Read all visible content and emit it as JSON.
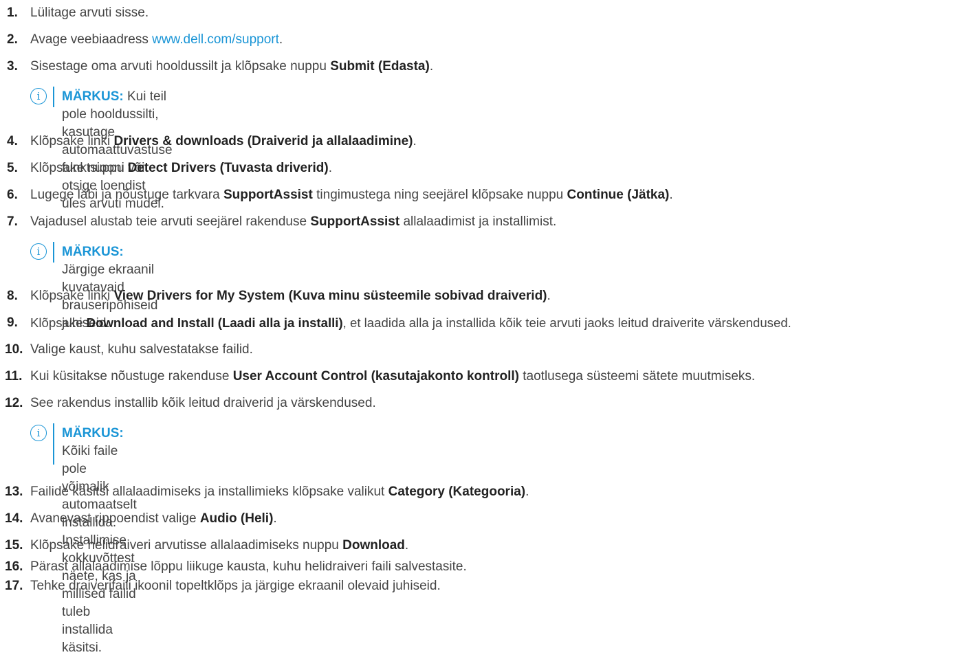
{
  "steps": [
    {
      "n": "1.",
      "parts": [
        {
          "t": "Lülitage arvuti sisse."
        }
      ]
    },
    {
      "n": "2.",
      "parts": [
        {
          "t": "Avage veebiaadress "
        },
        {
          "t": "www.dell.com/support",
          "link": true
        },
        {
          "t": "."
        }
      ]
    },
    {
      "n": "3.",
      "parts": [
        {
          "t": "Sisestage oma arvuti hooldussilt ja klõpsake nuppu "
        },
        {
          "t": "Submit (Edasta)",
          "b": true
        },
        {
          "t": "."
        }
      ]
    },
    {
      "n": "4.",
      "parts": [
        {
          "t": "Klõpsake linki "
        },
        {
          "t": "Drivers & downloads (Draiverid ja allalaadimine)",
          "b": true
        },
        {
          "t": "."
        }
      ]
    },
    {
      "n": "5.",
      "parts": [
        {
          "t": "Klõpsake nuppu "
        },
        {
          "t": "Detect Drivers (Tuvasta driverid)",
          "b": true
        },
        {
          "t": "."
        }
      ]
    },
    {
      "n": "6.",
      "parts": [
        {
          "t": "Lugege läbi ja nõustuge tarkvara "
        },
        {
          "t": "SupportAssist",
          "b": true
        },
        {
          "t": " tingimustega ning seejärel klõpsake nuppu "
        },
        {
          "t": "Continue (Jätka)",
          "b": true
        },
        {
          "t": "."
        }
      ]
    },
    {
      "n": "7.",
      "parts": [
        {
          "t": "Vajadusel alustab teie arvuti seejärel rakenduse "
        },
        {
          "t": "SupportAssist",
          "b": true
        },
        {
          "t": " allalaadimist ja installimist."
        }
      ]
    },
    {
      "n": "8.",
      "parts": [
        {
          "t": "Klõpsake linki "
        },
        {
          "t": "View Drivers for My System (Kuva minu süsteemile sobivad draiverid)",
          "b": true
        },
        {
          "t": "."
        }
      ]
    },
    {
      "n": "9.",
      "parts": [
        {
          "t": "Klõpsake "
        },
        {
          "t": "Download and Install (Laadi alla ja installi)",
          "b": true
        },
        {
          "t": ", et laadida alla ja installida kõik teie arvuti jaoks leitud draiverite värskendused."
        }
      ]
    },
    {
      "n": "10.",
      "parts": [
        {
          "t": "Valige kaust, kuhu salvestatakse failid."
        }
      ]
    },
    {
      "n": "11.",
      "parts": [
        {
          "t": "Kui küsitakse nõustuge rakenduse "
        },
        {
          "t": "User Account Control (kasutajakonto kontroll)",
          "b": true
        },
        {
          "t": " taotlusega süsteemi sätete muutmiseks."
        }
      ]
    },
    {
      "n": "12.",
      "parts": [
        {
          "t": "See rakendus installib kõik leitud draiverid ja värskendused."
        }
      ]
    },
    {
      "n": "13.",
      "parts": [
        {
          "t": "Failide käsitsi allalaadimiseks ja installimieks klõpsake valikut "
        },
        {
          "t": "Category (Kategooria)",
          "b": true
        },
        {
          "t": "."
        }
      ]
    },
    {
      "n": "14.",
      "parts": [
        {
          "t": "Avanevast rippoendist valige "
        },
        {
          "t": "Audio (Heli)",
          "b": true
        },
        {
          "t": "."
        }
      ]
    },
    {
      "n": "15.",
      "parts": [
        {
          "t": "Klõpsake helidraiveri arvutisse allalaadimiseks nuppu "
        },
        {
          "t": "Download",
          "b": true
        },
        {
          "t": "."
        }
      ]
    },
    {
      "n": "16.",
      "parts": [
        {
          "t": "Pärast allalaadimise lõppu liikuge kausta, kuhu helidraiveri faili salvestasite."
        }
      ]
    },
    {
      "n": "17.",
      "parts": [
        {
          "t": "Tehke draiverifaili ikoonil topeltklõps ja järgige ekraanil olevaid juhiseid."
        }
      ]
    }
  ],
  "notes": [
    {
      "icon": "i",
      "label": "MÄRKUS:",
      "lines": [
        "Kui teil pole hooldussilti, kasutage automaattuvastuse funktsiooni või otsige loendist üles arvuti mudel."
      ]
    },
    {
      "icon": "i",
      "label": "MÄRKUS:",
      "lines": [
        "Järgige ekraanil kuvatavaid brauseripõhiseid juhiseid."
      ]
    },
    {
      "icon": "i",
      "label": "MÄRKUS:",
      "lines": [
        "Kõiki faile pole võimalik automaatselt installida. Installimise kokkuvõttest näete, kas ja millised failid tuleb installida",
        "käsitsi."
      ]
    }
  ]
}
